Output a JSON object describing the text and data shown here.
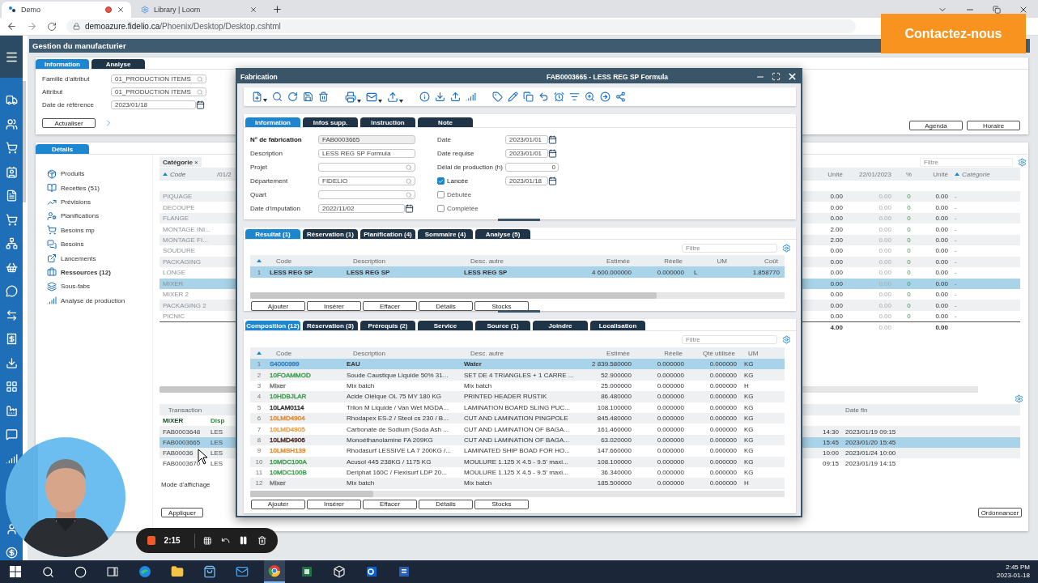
{
  "browser": {
    "tabs": [
      {
        "label": "Demo",
        "selected": true
      },
      {
        "label": "Library | Loom",
        "selected": false
      }
    ],
    "url_domain": "demoazure.fidelio.ca",
    "url_path": "/Phoenix/Desktop/Desktop.cshtml"
  },
  "contact_button": "Contactez-nous",
  "app": {
    "title": "Gestion du manufacturier",
    "tabs": [
      {
        "label": "Information",
        "selected": true
      },
      {
        "label": "Analyse",
        "selected": false
      }
    ],
    "filters": [
      {
        "label": "Famille d'attribut",
        "value": "01_PRODUCTION ITEMS",
        "kind": "search"
      },
      {
        "label": "Attribut",
        "value": "01_PRODUCTION ITEMS",
        "kind": "search"
      },
      {
        "label": "Date de référence",
        "value": "2023/01/18",
        "kind": "date"
      }
    ],
    "refresh_button": "Actualiser",
    "side_buttons": [
      "Agenda",
      "Horaire"
    ],
    "detail_tabs": [
      {
        "label": "Détails",
        "selected": true
      }
    ],
    "nav_items": [
      {
        "label": "Produits",
        "selected": false
      },
      {
        "label": "Recettes (51)",
        "selected": false
      },
      {
        "label": "Prévisions",
        "selected": false
      },
      {
        "label": "Planifications",
        "selected": false
      },
      {
        "label": "Besoins mp",
        "selected": false
      },
      {
        "label": "Besoins",
        "selected": false
      },
      {
        "label": "Lancements",
        "selected": false
      },
      {
        "label": "Ressources (12)",
        "selected": true
      },
      {
        "label": "Sous-fabs",
        "selected": false
      },
      {
        "label": "Analyse de production",
        "selected": false
      }
    ],
    "category_chip": {
      "label": "Catégorie",
      "remove": "×"
    },
    "filter_placeholder": "Filtre",
    "resources": {
      "left_columns": [
        "Code",
        "/01/2"
      ],
      "right_columns": [
        "Unité",
        "22/01/2023",
        "%",
        "Unité",
        "Catégorie"
      ],
      "rows": [
        {
          "code": "PIQUAGE",
          "unit": "0.00",
          "date_value": "0.00",
          "percent": "0",
          "unit_2": "0.00",
          "category": "-",
          "selected": false
        },
        {
          "code": "DECOUPE",
          "unit": "0.00",
          "date_value": "0.00",
          "percent": "0",
          "unit_2": "0.00",
          "category": "-",
          "selected": false
        },
        {
          "code": "FLANGE",
          "unit": "0.00",
          "date_value": "0.00",
          "percent": "0",
          "unit_2": "0.00",
          "category": "-",
          "selected": false
        },
        {
          "code": "MONTAGE INI...",
          "unit": "2.00",
          "date_value": "0.00",
          "percent": "0",
          "unit_2": "0.00",
          "category": "-",
          "selected": false
        },
        {
          "code": "MONTAGE FI...",
          "unit": "2.00",
          "date_value": "0.00",
          "percent": "0",
          "unit_2": "0.00",
          "category": "-",
          "selected": false
        },
        {
          "code": "SOUDURE",
          "unit": "0.00",
          "date_value": "0.00",
          "percent": "0",
          "unit_2": "0.00",
          "category": "-",
          "selected": false
        },
        {
          "code": "PACKAGING",
          "unit": "0.00",
          "date_value": "0.00",
          "percent": "0",
          "unit_2": "0.00",
          "category": "-",
          "selected": false
        },
        {
          "code": "LONGE",
          "unit": "0.00",
          "date_value": "0.00",
          "percent": "0",
          "unit_2": "0.00",
          "category": "-",
          "selected": false
        },
        {
          "code": "MIXER",
          "unit": "0.00",
          "date_value": "0.00",
          "percent": "0",
          "unit_2": "0.00",
          "category": "-",
          "selected": true
        },
        {
          "code": "MIXER 2",
          "unit": "0.00",
          "date_value": "0.00",
          "percent": "0",
          "unit_2": "0.00",
          "category": "-",
          "selected": false
        },
        {
          "code": "PACKAGING 2",
          "unit": "0.00",
          "date_value": "0.00",
          "percent": "0",
          "unit_2": "0.00",
          "category": "-",
          "selected": false
        },
        {
          "code": "PICNIC",
          "unit": "0.00",
          "date_value": "0.00",
          "percent": "0",
          "unit_2": "0.00",
          "category": "-",
          "selected": false
        }
      ],
      "totals": {
        "unit": "4.00",
        "date_value": "0.00",
        "unit_2": "0.00"
      }
    },
    "transactions": {
      "columns": [
        "Transaction",
        "Date fin"
      ],
      "rows": [
        {
          "kind": "group",
          "transaction": "MIXER",
          "column_2": "Disp",
          "selected": false
        },
        {
          "kind": "item",
          "transaction": "FAB0003648",
          "column_2": "LES",
          "time": "14:30",
          "date_end": "2023/01/19 09:15",
          "selected": false
        },
        {
          "kind": "item",
          "transaction": "FAB0003665",
          "column_2": "LES",
          "time": "15:45",
          "date_end": "2023/01/20 15:45",
          "selected": true
        },
        {
          "kind": "item",
          "transaction": "FAB00036",
          "column_2": "LES",
          "time": "10:00",
          "date_end": "2023/01/24 10:00",
          "selected": false
        },
        {
          "kind": "item",
          "transaction": "FAB0003670",
          "column_2": "LES",
          "time": "09:15",
          "date_end": "2023/01/19 14:15",
          "selected": false
        }
      ]
    },
    "display_mode_label": "Mode d'affichage",
    "apply_button": "Appliquer",
    "schedule_button": "Ordonnancer"
  },
  "dialog": {
    "title": "Fabrication",
    "subtitle": "FAB0003665 - LESS REG SP Formula",
    "tabs": [
      {
        "label": "Information",
        "selected": true
      },
      {
        "label": "Infos supp.",
        "selected": false
      },
      {
        "label": "Instruction",
        "selected": false
      },
      {
        "label": "Note",
        "selected": false
      }
    ],
    "fields_left": [
      {
        "label": "N° de fabrication",
        "value": "FAB0003665",
        "kind": "readonly"
      },
      {
        "label": "Description",
        "value": "LESS REG SP Formula",
        "kind": "text"
      },
      {
        "label": "Projet",
        "kind": "search"
      },
      {
        "label": "Département",
        "value": "FIDELIO",
        "kind": "search"
      },
      {
        "label": "Quart",
        "kind": "search"
      },
      {
        "label": "Date d'imputation",
        "value": "2022/11/02",
        "kind": "date"
      }
    ],
    "fields_right": [
      {
        "label": "Date",
        "value": "2023/01/01",
        "kind": "date"
      },
      {
        "label": "Date requise",
        "value": "2023/01/01",
        "kind": "date"
      },
      {
        "label": "Délai de production (h)",
        "value": "0",
        "kind": "number"
      },
      {
        "label": "Lancée",
        "checked": true,
        "value": "2023/01/18",
        "kind": "check"
      },
      {
        "label": "Débutée",
        "checked": false,
        "kind": "check"
      },
      {
        "label": "Complétée",
        "checked": false,
        "kind": "check"
      }
    ],
    "result": {
      "tabs": [
        {
          "label": "Résultat (1)",
          "selected": true
        },
        {
          "label": "Réservation (1)",
          "selected": false
        },
        {
          "label": "Planification (4)",
          "selected": false
        },
        {
          "label": "Sommaire (4)",
          "selected": false
        },
        {
          "label": "Analyse (5)",
          "selected": false
        }
      ],
      "filter_placeholder": "Filtre",
      "columns": [
        "Code",
        "Description",
        "Desc. autre",
        "Estimée",
        "Réelle",
        "UM",
        "Coût"
      ],
      "rows": [
        {
          "number": "1",
          "cells": [
            "LESS REG SP",
            "LESS REG SP",
            "LESS REG SP",
            "4 600.000000",
            "0.000000",
            "L",
            "1.858770"
          ],
          "selected": true
        }
      ],
      "buttons": [
        "Ajouter",
        "Insérer",
        "Effacer",
        "Détails",
        "Stocks"
      ]
    },
    "composition": {
      "tabs": [
        {
          "label": "Composition (12)",
          "selected": true
        },
        {
          "label": "Réservation (3)",
          "selected": false
        },
        {
          "label": "Prérequis (2)",
          "selected": false
        },
        {
          "label": "Service",
          "selected": false
        },
        {
          "label": "Source (1)",
          "selected": false
        },
        {
          "label": "Joindre",
          "selected": false
        },
        {
          "label": "Localisation",
          "selected": false
        }
      ],
      "filter_placeholder": "Filtre",
      "columns": [
        "Code",
        "Description",
        "Desc. autre",
        "Estimée",
        "Réelle",
        "Qté utilisée",
        "UM"
      ],
      "rows": [
        {
          "number": "1",
          "code": "S4000999",
          "color": "#2f7fc4",
          "description": "EAU",
          "desc_other": "Water",
          "estimated": "2 839.580000",
          "actual": "0.000000",
          "used": "0.000000",
          "unit": "KG",
          "selected": true
        },
        {
          "number": "2",
          "code": "10FOAMMOD",
          "color": "#3f9f4f",
          "description": "Soude Caustique Liquide 50% 31...",
          "desc_other": "SET DE 4 TRIANGLES + 1 CARRE ...",
          "estimated": "52.900000",
          "actual": "0.000000",
          "used": "0.000000",
          "unit": "KG",
          "selected": false
        },
        {
          "number": "3",
          "code": "Mixer",
          "color": "#7d7d7d",
          "description": "Mix batch",
          "desc_other": "Mix batch",
          "estimated": "25.000000",
          "actual": "0.000000",
          "used": "0.000000",
          "unit": "H",
          "selected": false
        },
        {
          "number": "4",
          "code": "10HDBJLAR",
          "color": "#3f9f4f",
          "description": "Acide Oléique OL 75 MY 180 KG",
          "desc_other": "PRINTED HEADER RUSTIK",
          "estimated": "86.480000",
          "actual": "0.000000",
          "used": "0.000000",
          "unit": "KG",
          "selected": false
        },
        {
          "number": "5",
          "code": "10LAM0114",
          "color": "#333333",
          "description": "Trilon M Liquide / Van Wet MGDA...",
          "desc_other": "LAMINATION BOARD SLING PUC...",
          "estimated": "108.100000",
          "actual": "0.000000",
          "used": "0.000000",
          "unit": "KG",
          "selected": false
        },
        {
          "number": "6",
          "code": "10LMD4904",
          "color": "#e8892b",
          "description": "Rhodapex ES-2 / Steol cs 230 / B...",
          "desc_other": "CUT AND LAMINATION PINGPOLE",
          "estimated": "845.480000",
          "actual": "0.000000",
          "used": "0.000000",
          "unit": "KG",
          "selected": false
        },
        {
          "number": "7",
          "code": "10LMD4905",
          "color": "#eaa04a",
          "description": "Carbonate de Sodium (Soda Ash ...",
          "desc_other": "CUT AND LAMINATION OF BAGA...",
          "estimated": "161.460000",
          "actual": "0.000000",
          "used": "0.000000",
          "unit": "KG",
          "selected": false
        },
        {
          "number": "8",
          "code": "10LMD4906",
          "color": "#4a2a20",
          "description": "Monoéthanolamine FA 209KG",
          "desc_other": "CUT AND LAMINATION OF BAGA...",
          "estimated": "63.020000",
          "actual": "0.000000",
          "used": "0.000000",
          "unit": "KG",
          "selected": false
        },
        {
          "number": "9",
          "code": "10LMSH139",
          "color": "#e8892b",
          "description": "Rhodasurf LESSIVE LA 7 200KG /...",
          "desc_other": "LAMINATED SHIP BOAD FOR HO...",
          "estimated": "147.660000",
          "actual": "0.000000",
          "used": "0.000000",
          "unit": "KG",
          "selected": false
        },
        {
          "number": "10",
          "code": "10MDC100A",
          "color": "#3f9f4f",
          "description": "Acusol 445 238KG / 1175 KG",
          "desc_other": "MOULURE 1.125 X 4.5 - 9.5' maxi...",
          "estimated": "108.100000",
          "actual": "0.000000",
          "used": "0.000000",
          "unit": "KG",
          "selected": false
        },
        {
          "number": "11",
          "code": "10MDC100B",
          "color": "#3f9f4f",
          "description": "Deriphat 160C / Flexisurf LDP 20...",
          "desc_other": "MOULURE 1.125 X 4.5 - 9.5' maxi...",
          "estimated": "36.340000",
          "actual": "0.000000",
          "used": "0.000000",
          "unit": "KG",
          "selected": false
        },
        {
          "number": "12",
          "code": "Mixer",
          "color": "#7d7d7d",
          "description": "Mix batch",
          "desc_other": "Mix batch",
          "estimated": "185.500000",
          "actual": "0.000000",
          "used": "0.000000",
          "unit": "H",
          "selected": false
        }
      ],
      "buttons": [
        "Ajouter",
        "Insérer",
        "Effacer",
        "Détails",
        "Stocks"
      ]
    }
  },
  "recorder": {
    "timer": "2:15"
  },
  "taskbar": {
    "time": "2:45 PM",
    "date": "2023-01-18"
  }
}
